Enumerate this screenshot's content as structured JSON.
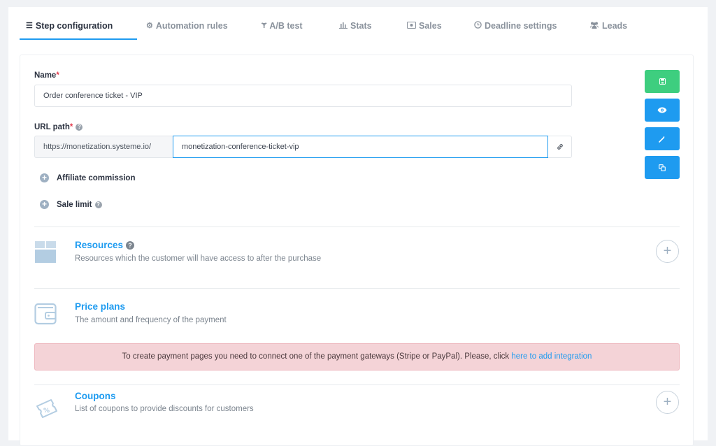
{
  "tabs": [
    {
      "label": "Step configuration",
      "icon": "list-icon",
      "active": true
    },
    {
      "label": "Automation rules",
      "icon": "cogs-icon"
    },
    {
      "label": "A/B test",
      "icon": "fork-icon"
    },
    {
      "label": "Stats",
      "icon": "bar-chart-icon"
    },
    {
      "label": "Sales",
      "icon": "money-icon"
    },
    {
      "label": "Deadline settings",
      "icon": "clock-icon"
    },
    {
      "label": "Leads",
      "icon": "users-icon"
    }
  ],
  "form": {
    "name_label": "Name",
    "required_mark": "*",
    "name_value": "Order conference ticket - VIP",
    "url_label": "URL path",
    "url_prefix": "https://monetization.systeme.io/",
    "url_value": "monetization-conference-ticket-vip",
    "affiliate_label": "Affiliate commission",
    "sale_limit_label": "Sale limit"
  },
  "actions": {
    "save_color": "#3ece7f",
    "action_color": "#1e9bf0"
  },
  "sections": {
    "resources": {
      "title": "Resources",
      "desc": "Resources which the customer will have access to after the purchase"
    },
    "price_plans": {
      "title": "Price plans",
      "desc": "The amount and frequency of the payment"
    },
    "coupons": {
      "title": "Coupons",
      "desc": "List of coupons to provide discounts for customers"
    }
  },
  "alert": {
    "text": "To create payment pages you need to connect one of the payment gateways (Stripe or PayPal). Please, click ",
    "link": "here to add integration"
  }
}
